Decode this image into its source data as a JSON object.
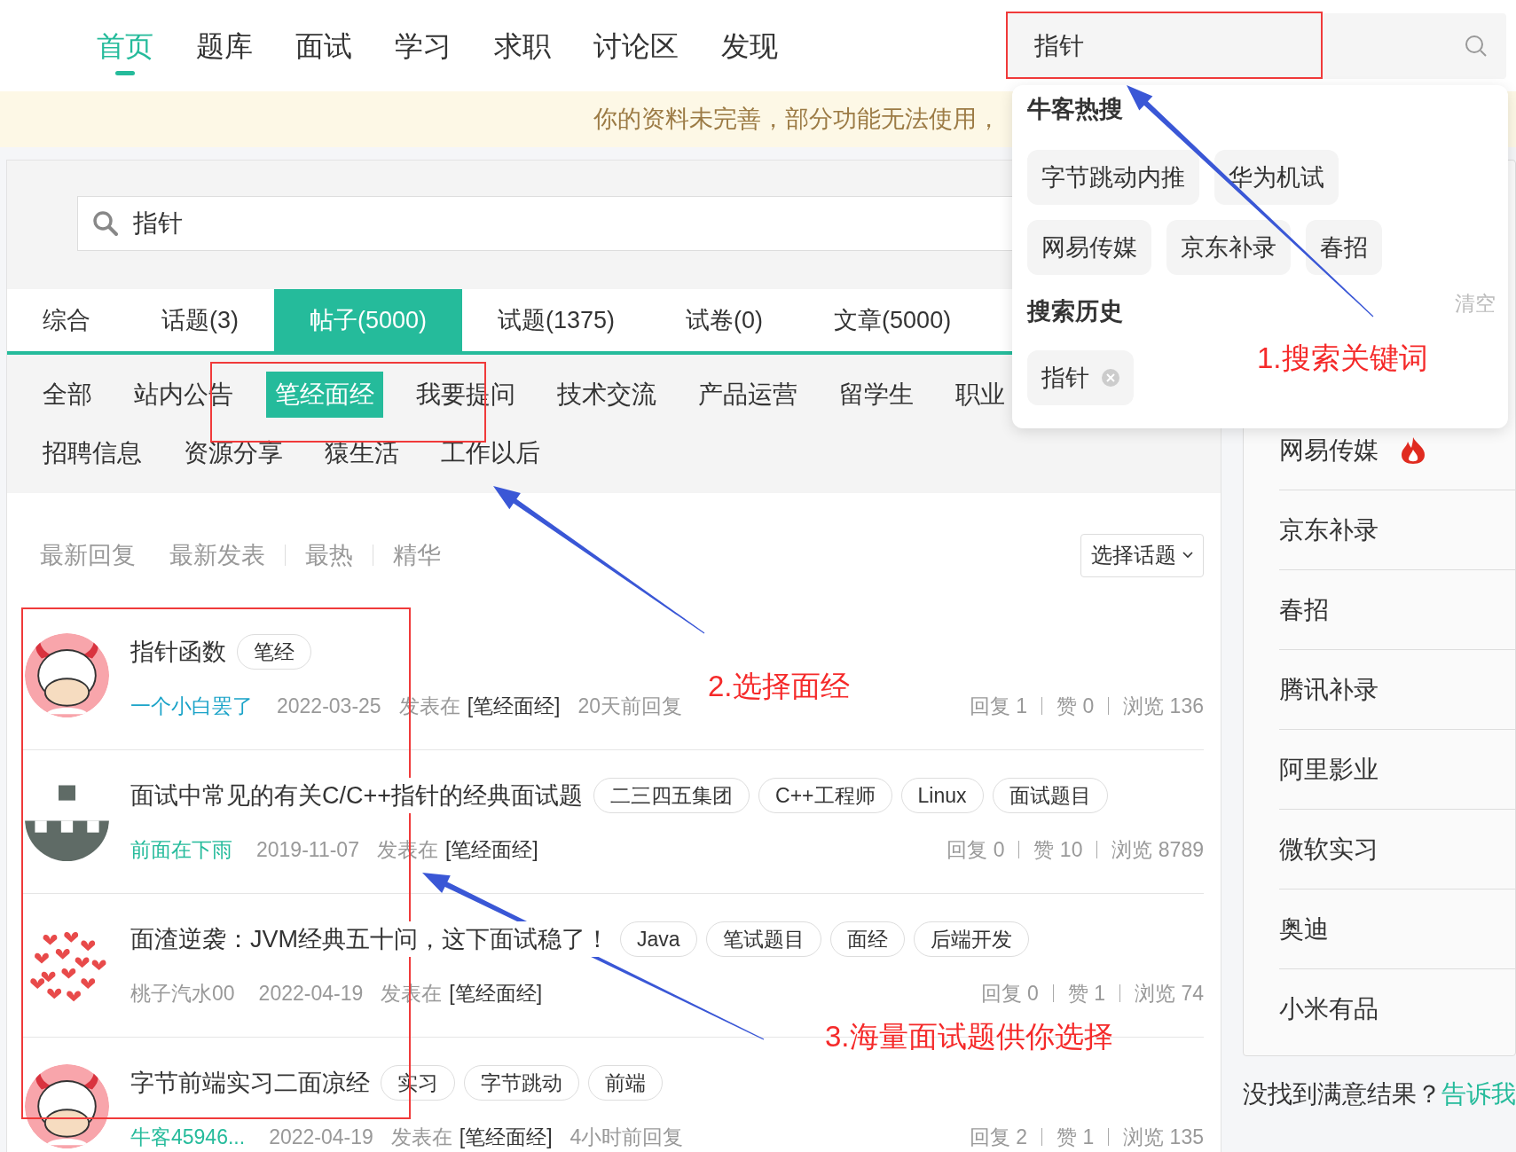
{
  "nav": {
    "items": [
      {
        "label": "首页",
        "selected": true
      },
      {
        "label": "题库",
        "selected": false
      },
      {
        "label": "面试",
        "selected": false
      },
      {
        "label": "学习",
        "selected": false
      },
      {
        "label": "求职",
        "selected": false
      },
      {
        "label": "讨论区",
        "selected": false
      },
      {
        "label": "发现",
        "selected": false
      }
    ],
    "search": {
      "value": "指针"
    }
  },
  "notice": "你的资料未完善，部分功能无法使用，",
  "search": {
    "value": "指针"
  },
  "result_tabs": [
    {
      "label": "综合",
      "selected": false
    },
    {
      "label": "话题(3)",
      "selected": false
    },
    {
      "label": "帖子(5000)",
      "selected": true
    },
    {
      "label": "试题(1375)",
      "selected": false
    },
    {
      "label": "试卷(0)",
      "selected": false
    },
    {
      "label": "文章(5000)",
      "selected": false
    }
  ],
  "category_rows": [
    [
      {
        "label": "全部",
        "selected": false
      },
      {
        "label": "站内公告",
        "selected": false
      },
      {
        "label": "笔经面经",
        "selected": true
      },
      {
        "label": "我要提问",
        "selected": false
      },
      {
        "label": "技术交流",
        "selected": false
      },
      {
        "label": "产品运营",
        "selected": false
      },
      {
        "label": "留学生",
        "selected": false
      },
      {
        "label": "职业",
        "selected": false
      }
    ],
    [
      {
        "label": "招聘信息",
        "selected": false
      },
      {
        "label": "资源分享",
        "selected": false
      },
      {
        "label": "猿生活",
        "selected": false
      },
      {
        "label": "工作以后",
        "selected": false
      }
    ]
  ],
  "sort": [
    {
      "label": "最新回复",
      "separated": false
    },
    {
      "label": "最新发表",
      "separated": false
    },
    {
      "label": "最热",
      "separated": true
    },
    {
      "label": "精华",
      "separated": true
    }
  ],
  "topic_select": "选择话题",
  "posts": [
    {
      "title": "指针函数",
      "tags": [
        "笔经"
      ],
      "author": {
        "name": "一个小白罢了",
        "color": "#1aa3c8"
      },
      "date": "2022-03-25",
      "posted_in": "发表在",
      "board": "[笔经面经]",
      "last_reply": "20天前回复",
      "stats": [
        "回复 1",
        "赞 0",
        "浏览 136"
      ]
    },
    {
      "title": "面试中常见的有关C/C++指针的经典面试题",
      "tags": [
        "二三四五集团",
        "C++工程师",
        "Linux",
        "面试题目"
      ],
      "author": {
        "name": "前面在下雨",
        "color": "#25bb9b"
      },
      "date": "2019-11-07",
      "posted_in": "发表在",
      "board": "[笔经面经]",
      "stats": [
        "回复 0",
        "赞 10",
        "浏览 8789"
      ]
    },
    {
      "title": "面渣逆袭：JVM经典五十问，这下面试稳了！",
      "tags": [
        "Java",
        "笔试题目",
        "面经",
        "后端开发"
      ],
      "author": {
        "name": "桃子汽水00",
        "color": "#999999"
      },
      "date": "2022-04-19",
      "posted_in": "发表在",
      "board": "[笔经面经]",
      "stats": [
        "回复 0",
        "赞 1",
        "浏览 74"
      ]
    },
    {
      "title": "字节前端实习二面凉经",
      "tags": [
        "实习",
        "字节跳动",
        "前端"
      ],
      "author": {
        "name": "牛客45946...",
        "color": "#25bb9b"
      },
      "date": "2022-04-19",
      "posted_in": "发表在",
      "board": "[笔经面经]",
      "last_reply": "4小时前回复",
      "stats": [
        "回复 2",
        "赞 1",
        "浏览 135"
      ]
    }
  ],
  "sidebar": {
    "items": [
      {
        "label": "网易传媒",
        "hot": true
      },
      {
        "label": "京东补录",
        "hot": false
      },
      {
        "label": "春招",
        "hot": false
      },
      {
        "label": "腾讯补录",
        "hot": false
      },
      {
        "label": "阿里影业",
        "hot": false
      },
      {
        "label": "微软实习",
        "hot": false
      },
      {
        "label": "奥迪",
        "hot": false
      },
      {
        "label": "小米有品",
        "hot": false
      }
    ],
    "feedback": "没找到满意结果？",
    "feedback_link": "告诉我"
  },
  "dropdown": {
    "hot_title": "牛客热搜",
    "hot": [
      "字节跳动内推",
      "华为机试",
      "网易传媒",
      "京东补录",
      "春招"
    ],
    "history_title": "搜索历史",
    "clear": "清空",
    "history": [
      "指针"
    ]
  },
  "annotations": [
    {
      "text": "1.搜索关键词"
    },
    {
      "text": "2.选择面经"
    },
    {
      "text": "3.海量面试题供你选择"
    }
  ]
}
